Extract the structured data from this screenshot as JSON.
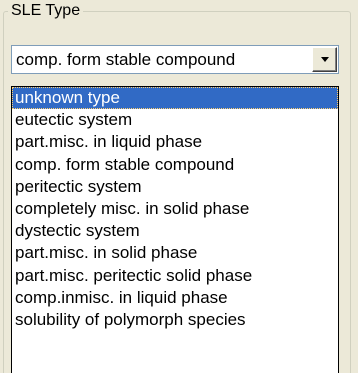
{
  "colors": {
    "window_bg": "#ece9d8",
    "selection_bg": "#316ac5",
    "selection_text": "#ffffff",
    "combo_border": "#7f9db9"
  },
  "group": {
    "caption": "SLE Type"
  },
  "combo": {
    "selected_value": "comp. form stable compound",
    "arrow_icon": "chevron-down-icon"
  },
  "dropdown": {
    "highlighted_index": 0,
    "options": [
      "unknown type",
      "eutectic system",
      "part.misc. in liquid phase",
      "comp. form stable compound",
      "peritectic system",
      "completely misc. in solid phase",
      "dystectic system",
      "part.misc. in solid phase",
      "part.misc. peritectic solid phase",
      "comp.inmisc. in liquid phase",
      "solubility of polymorph species"
    ]
  }
}
